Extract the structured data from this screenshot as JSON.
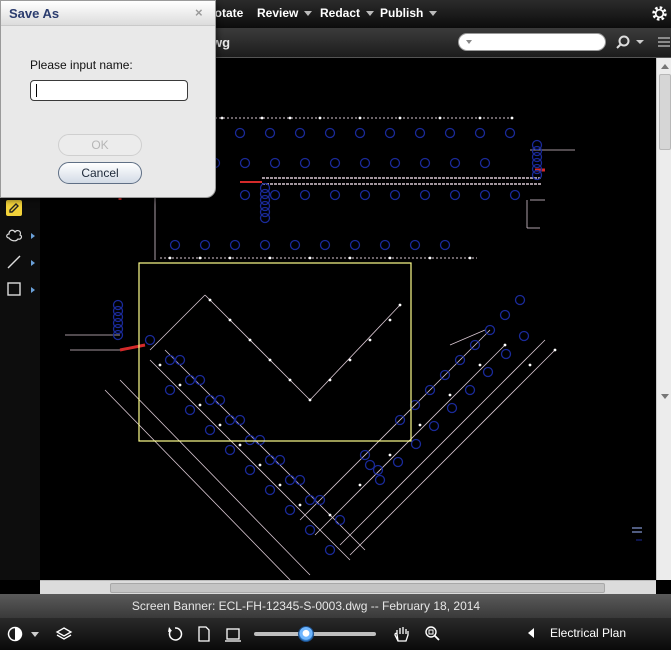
{
  "menubar": {
    "items": [
      {
        "label": "nnotate",
        "has_dropdown": false
      },
      {
        "label": "Review",
        "has_dropdown": true
      },
      {
        "label": "Redact",
        "has_dropdown": true
      },
      {
        "label": "Publish",
        "has_dropdown": true
      }
    ],
    "settings_icon": "gear-icon"
  },
  "titlebar": {
    "document_title_partial": "wg",
    "search": {
      "value": "",
      "placeholder": ""
    },
    "search_icon": "magnifier-icon",
    "overflow_icon": "menu-icon"
  },
  "toolstrip": {
    "tools": [
      {
        "name": "markup-pencil-tool",
        "icon": "pencil-icon",
        "active": true
      },
      {
        "name": "cloud-tool",
        "icon": "cloud-icon",
        "active": false
      },
      {
        "name": "line-tool",
        "icon": "line-icon",
        "active": false
      },
      {
        "name": "rectangle-tool",
        "icon": "rectangle-icon",
        "active": false
      }
    ]
  },
  "banner": {
    "text": "Screen Banner: ECL-FH-12345-S-0003.dwg -- February 18, 2014"
  },
  "bottombar": {
    "tools": [
      "contrast-icon",
      "layers-icon",
      "rotate-icon",
      "page-icon",
      "fit-page-icon",
      "pan-hand-icon",
      "zoom-window-icon"
    ],
    "zoom_level": 0.43,
    "layout_name": "Electrical Plan"
  },
  "dialog": {
    "title": "Save As",
    "close_label": "×",
    "prompt": "Please input name:",
    "input_value": "",
    "ok_label": "OK",
    "cancel_label": "Cancel",
    "ok_enabled": false
  },
  "colors": {
    "canvas_background": "#000000",
    "drawing_lines": "#d9c7d2",
    "fixtures": "#1a2a9a",
    "selection_rectangle": "#ffff8c",
    "highlight": "#d42a2a",
    "accent": "#3b86d8"
  }
}
